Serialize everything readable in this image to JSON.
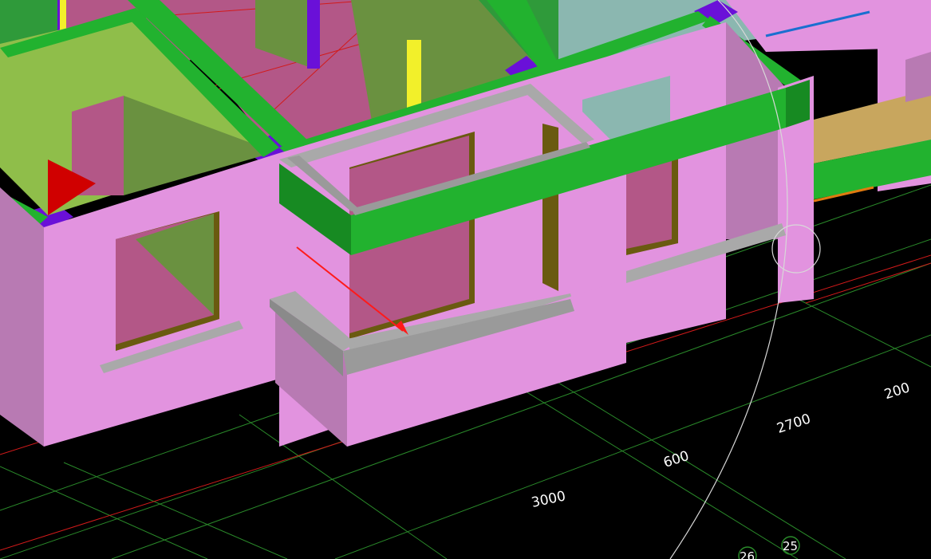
{
  "viewport": {
    "view_type": "3D isometric model view",
    "background_color": "#000000"
  },
  "dimensions": {
    "dim_3000": "3000",
    "dim_600": "600",
    "dim_2700": "2700",
    "dim_200": "200"
  },
  "axis_labels": {
    "axis_25": "25",
    "axis_26": "26"
  },
  "colors": {
    "wall": "#e293df",
    "wall_shade": "#b87ab3",
    "beam": "#22b22f",
    "beam_dark": "#178a22",
    "column": "#6a10d8",
    "slab": "#8fb645",
    "floor": "#b35787",
    "sill": "#a9a9a9",
    "sill_dark": "#8a8a8a",
    "glass": "#8bb7b0",
    "frame": "#6a5a10",
    "yellow_strip": "#f2f02a",
    "grid_green": "#2a8a2a",
    "grid_red": "#d21a1a",
    "tan_surface": "#c8a65e"
  },
  "elements": {
    "selection_pointer": "red-arrow",
    "rotation_gizmo": "orbit-circle"
  }
}
